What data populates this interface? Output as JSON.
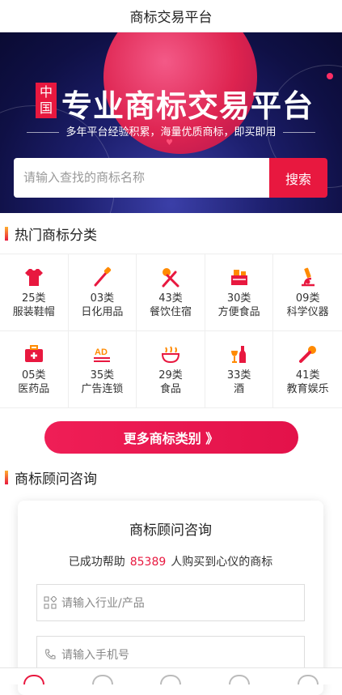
{
  "title": "商标交易平台",
  "banner": {
    "badge": "中国",
    "headline": "专业商标交易平台",
    "subline": "多年平台经验积累，海量优质商标，即买即用"
  },
  "search": {
    "placeholder": "请输入查找的商标名称",
    "button": "搜索"
  },
  "categories_section": {
    "title": "热门商标分类",
    "items": [
      {
        "code": "25类",
        "name": "服装鞋帽",
        "icon": "tshirt-icon"
      },
      {
        "code": "03类",
        "name": "日化用品",
        "icon": "toothbrush-icon"
      },
      {
        "code": "43类",
        "name": "餐饮住宿",
        "icon": "utensils-icon"
      },
      {
        "code": "30类",
        "name": "方便食品",
        "icon": "food-icon"
      },
      {
        "code": "09类",
        "name": "科学仪器",
        "icon": "microscope-icon"
      },
      {
        "code": "05类",
        "name": "医药品",
        "icon": "medkit-icon"
      },
      {
        "code": "35类",
        "name": "广告连锁",
        "icon": "ad-icon"
      },
      {
        "code": "29类",
        "name": "食品",
        "icon": "bowl-icon"
      },
      {
        "code": "33类",
        "name": "酒",
        "icon": "wine-icon"
      },
      {
        "code": "41类",
        "name": "教育娱乐",
        "icon": "microphone-icon"
      }
    ],
    "more_button": "更多商标类别 》"
  },
  "consult_section": {
    "title": "商标顾问咨询",
    "card_title": "商标顾问咨询",
    "helped_prefix": "已成功帮助",
    "helped_count": "85389",
    "helped_suffix": "人购买到心仪的商标",
    "industry_placeholder": "请输入行业/产品",
    "phone_placeholder": "请输入手机号"
  },
  "colors": {
    "accent": "#e8183f",
    "banner_bg": "#1d1f6e"
  }
}
